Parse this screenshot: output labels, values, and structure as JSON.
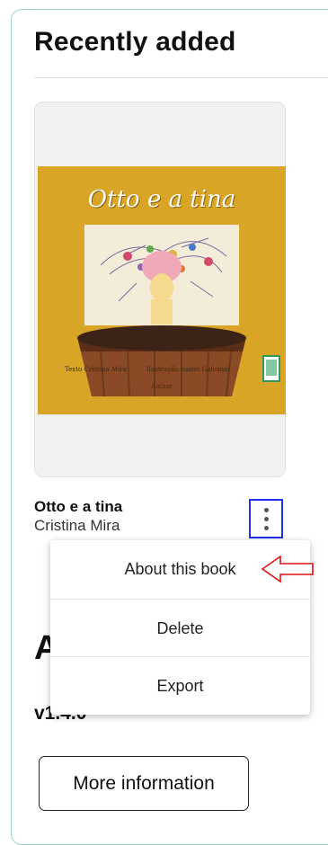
{
  "section": {
    "title": "Recently added"
  },
  "book": {
    "cover_title": "Otto e a tina",
    "cover_credit_text": "Texto Cristina Mira",
    "cover_credit_illus": "Ilustração Isabel Galvanni",
    "cover_publisher": "Ambar",
    "title": "Otto e a tina",
    "author": "Cristina Mira",
    "cover_color": "#d8a526"
  },
  "menu": {
    "items": [
      {
        "label": "About this book"
      },
      {
        "label": "Delete"
      },
      {
        "label": "Export"
      }
    ]
  },
  "background": {
    "heading_fragment": "A",
    "version": "v1.4.0",
    "more_label": "More information"
  },
  "colors": {
    "kebab_border": "#1d2ff0",
    "annotation_arrow": "#e01010",
    "panel_border": "#9ed3cc"
  }
}
